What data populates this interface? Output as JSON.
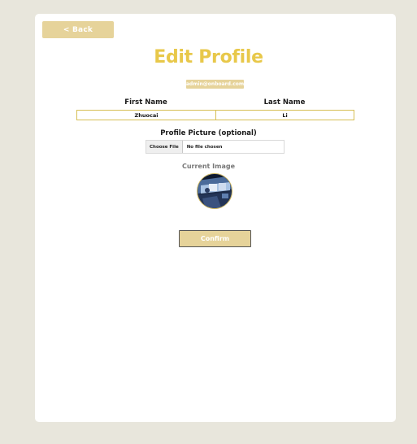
{
  "header": {
    "back_label": "< Back",
    "title": "Edit Profile",
    "email": "admin@onboard.com"
  },
  "form": {
    "first_name": {
      "label": "First Name",
      "value": "Zhuocai"
    },
    "last_name": {
      "label": "Last Name",
      "value": "Li"
    },
    "picture": {
      "label": "Profile Picture (optional)",
      "button_label": "Choose File",
      "status": "No file chosen"
    },
    "current_image": {
      "label": "Current Image",
      "icon": "profile-photo"
    },
    "confirm_label": "Confirm"
  },
  "colors": {
    "background": "#e8e6dc",
    "card": "#ffffff",
    "accent": "#e8c84a",
    "button": "#e6d39a",
    "input_border": "#d6bf55"
  }
}
